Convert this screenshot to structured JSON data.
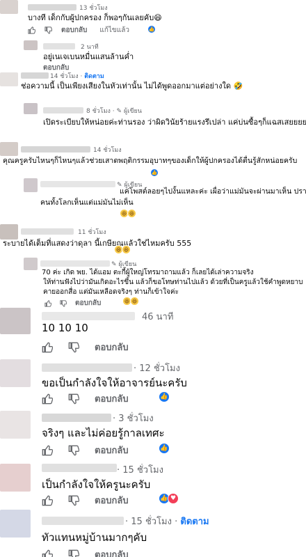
{
  "labels": {
    "like": "",
    "reply": "ตอบกลับ",
    "edit": "แก้ไขแล้ว",
    "follow": "ติดตาม",
    "author_badge": "ผู้เขียน",
    "sep": "·"
  },
  "colors": {
    "accent": "#1877f2",
    "meta": "#65676b",
    "love": "#f33e58",
    "haha": "#f7c948"
  },
  "comments": [
    {
      "time": "13 ชั่วโมง",
      "text": "บางที เด็กกับผู้ปกครอง ก็พอๆกันเลยคับ😄",
      "edited": "แก้ไขแล้ว",
      "reactions": [
        "like"
      ]
    },
    {
      "time": "2 นาที",
      "text": "อยู่เนเจเบนหมื่นแสนล้านค่ำ",
      "reactions": []
    },
    {
      "time": "14 ชั่วโมง",
      "follow": "ติดตาม",
      "text": "ช่อความนี้ เป็นเพียงเสียงในหัวเท่านั้น ไม่ได้พูดออกมาแต่อย่างใด 🤣",
      "reactions": []
    },
    {
      "time": "8 ชั่วโมง",
      "author": "ผู้เขียน",
      "text": "เปิดระเบียบให้หน่อยค่ะท่านรอง ว่าผิดวินัยร้ายแรงรึเปล่า แค่บ่นซื้อๆก็แฉสเสยยยย",
      "reactions": []
    },
    {
      "time": "14 ชั่วโมง",
      "text": "คุณครูครับไหนๆก็ไหนๆแล้วช่วยเสาดพฤติกรรมอุบาทๆของเด็กให้ผู้ปกครองได้ตื่นรู้สักหน่อยครับ",
      "reactions": [
        "like"
      ]
    },
    {
      "time": "",
      "author": "ผู้เขียน",
      "text_lines": [
        "แค่โพสต์ลอยๆไปงั้นแหละค่ะ เผื่อว่าแม่มันจะผ่านมาเห็น ปรากฎว่า",
        "คนทั้งโลกเห็นแต่แม่มันไม่เห็น"
      ],
      "reactions": [
        "haha",
        "haha"
      ]
    },
    {
      "time": "11 ชั่วโมง",
      "text": "ระบายได้เต็มที่แสดงว่าดุลา นี้เกษียณแล้วใช่ไหมครับ 555",
      "reactions": [
        "haha",
        "haha"
      ]
    },
    {
      "time": "",
      "author": "ผู้เขียน",
      "text_lines": [
        "70 ค่ะ เกิด พย. ได้แอม ตะกี้ผู้ใหญ่โทรมาถามแล้ว ก็เลยได้เล่าความจริง",
        "ให้ท่านฟังไปว่ามันเกิดอะไรขึ้น แล้วก็ขอโทษท่านไปแล้ว ด้วยที่เป็นครูแล้วใช้คำพูดหยาบ",
        "คายออกสื่อ แต่มันเหลือดจริงๆ ท่านก็เข้าใจค่ะ"
      ],
      "reactions": [
        "haha",
        "haha"
      ]
    },
    {
      "time": "46 นาที",
      "text": "10 10 10",
      "reactions": []
    },
    {
      "time": "12 ชั่วโมง",
      "text": "ขอเป็นกำลังใจให้อาจารย์นะครับ",
      "reactions": [
        "like"
      ]
    },
    {
      "time": "3 ชั่วโมง",
      "text": "จริงๆ และไม่ค่อยรู้กาลเทศะ",
      "reactions": [
        "like"
      ]
    },
    {
      "time": "15 ชั่วโมง",
      "text": "เป็นกำลังใจให้ครูนะครับ",
      "reactions": [
        "like",
        "love"
      ]
    },
    {
      "time": "15 ชั่วโมง",
      "follow": "ติดตาม",
      "text": "ทัวแทนหมู่บ้านมากๆคับ",
      "reactions": []
    }
  ]
}
